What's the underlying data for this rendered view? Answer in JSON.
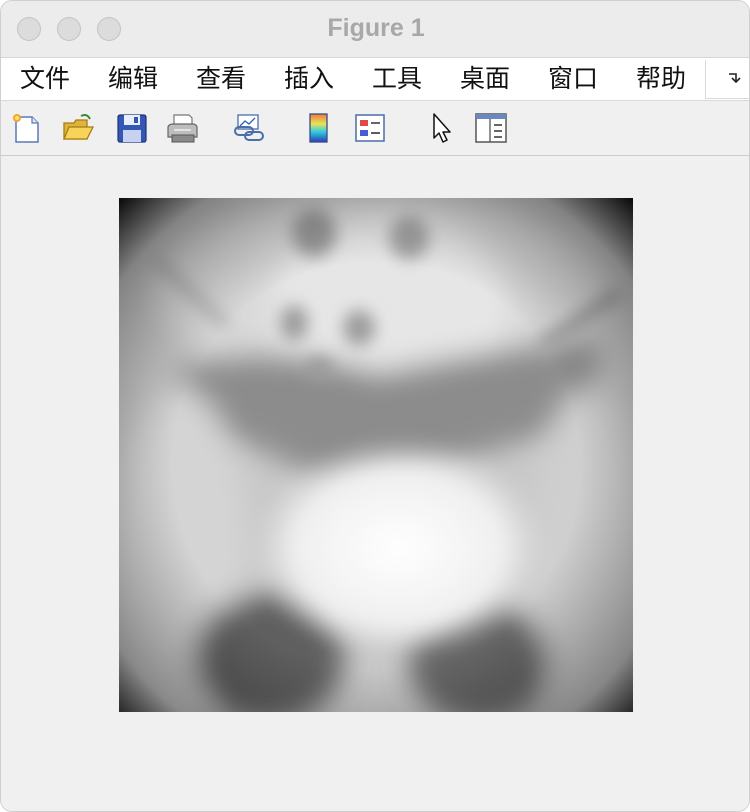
{
  "window": {
    "title": "Figure 1"
  },
  "menu": {
    "items": [
      "文件",
      "编辑",
      "查看",
      "插入",
      "工具",
      "桌面",
      "窗口",
      "帮助"
    ],
    "overflow_icon": "overflow-arrow-icon"
  },
  "toolbar": {
    "icons": [
      "new-figure-icon",
      "open-file-icon",
      "save-icon",
      "print-icon",
      "link-plot-icon",
      "colorbar-icon",
      "legend-icon",
      "pointer-icon",
      "property-inspector-icon"
    ]
  },
  "figure": {
    "image_subject": "grayscale-panda-image"
  }
}
